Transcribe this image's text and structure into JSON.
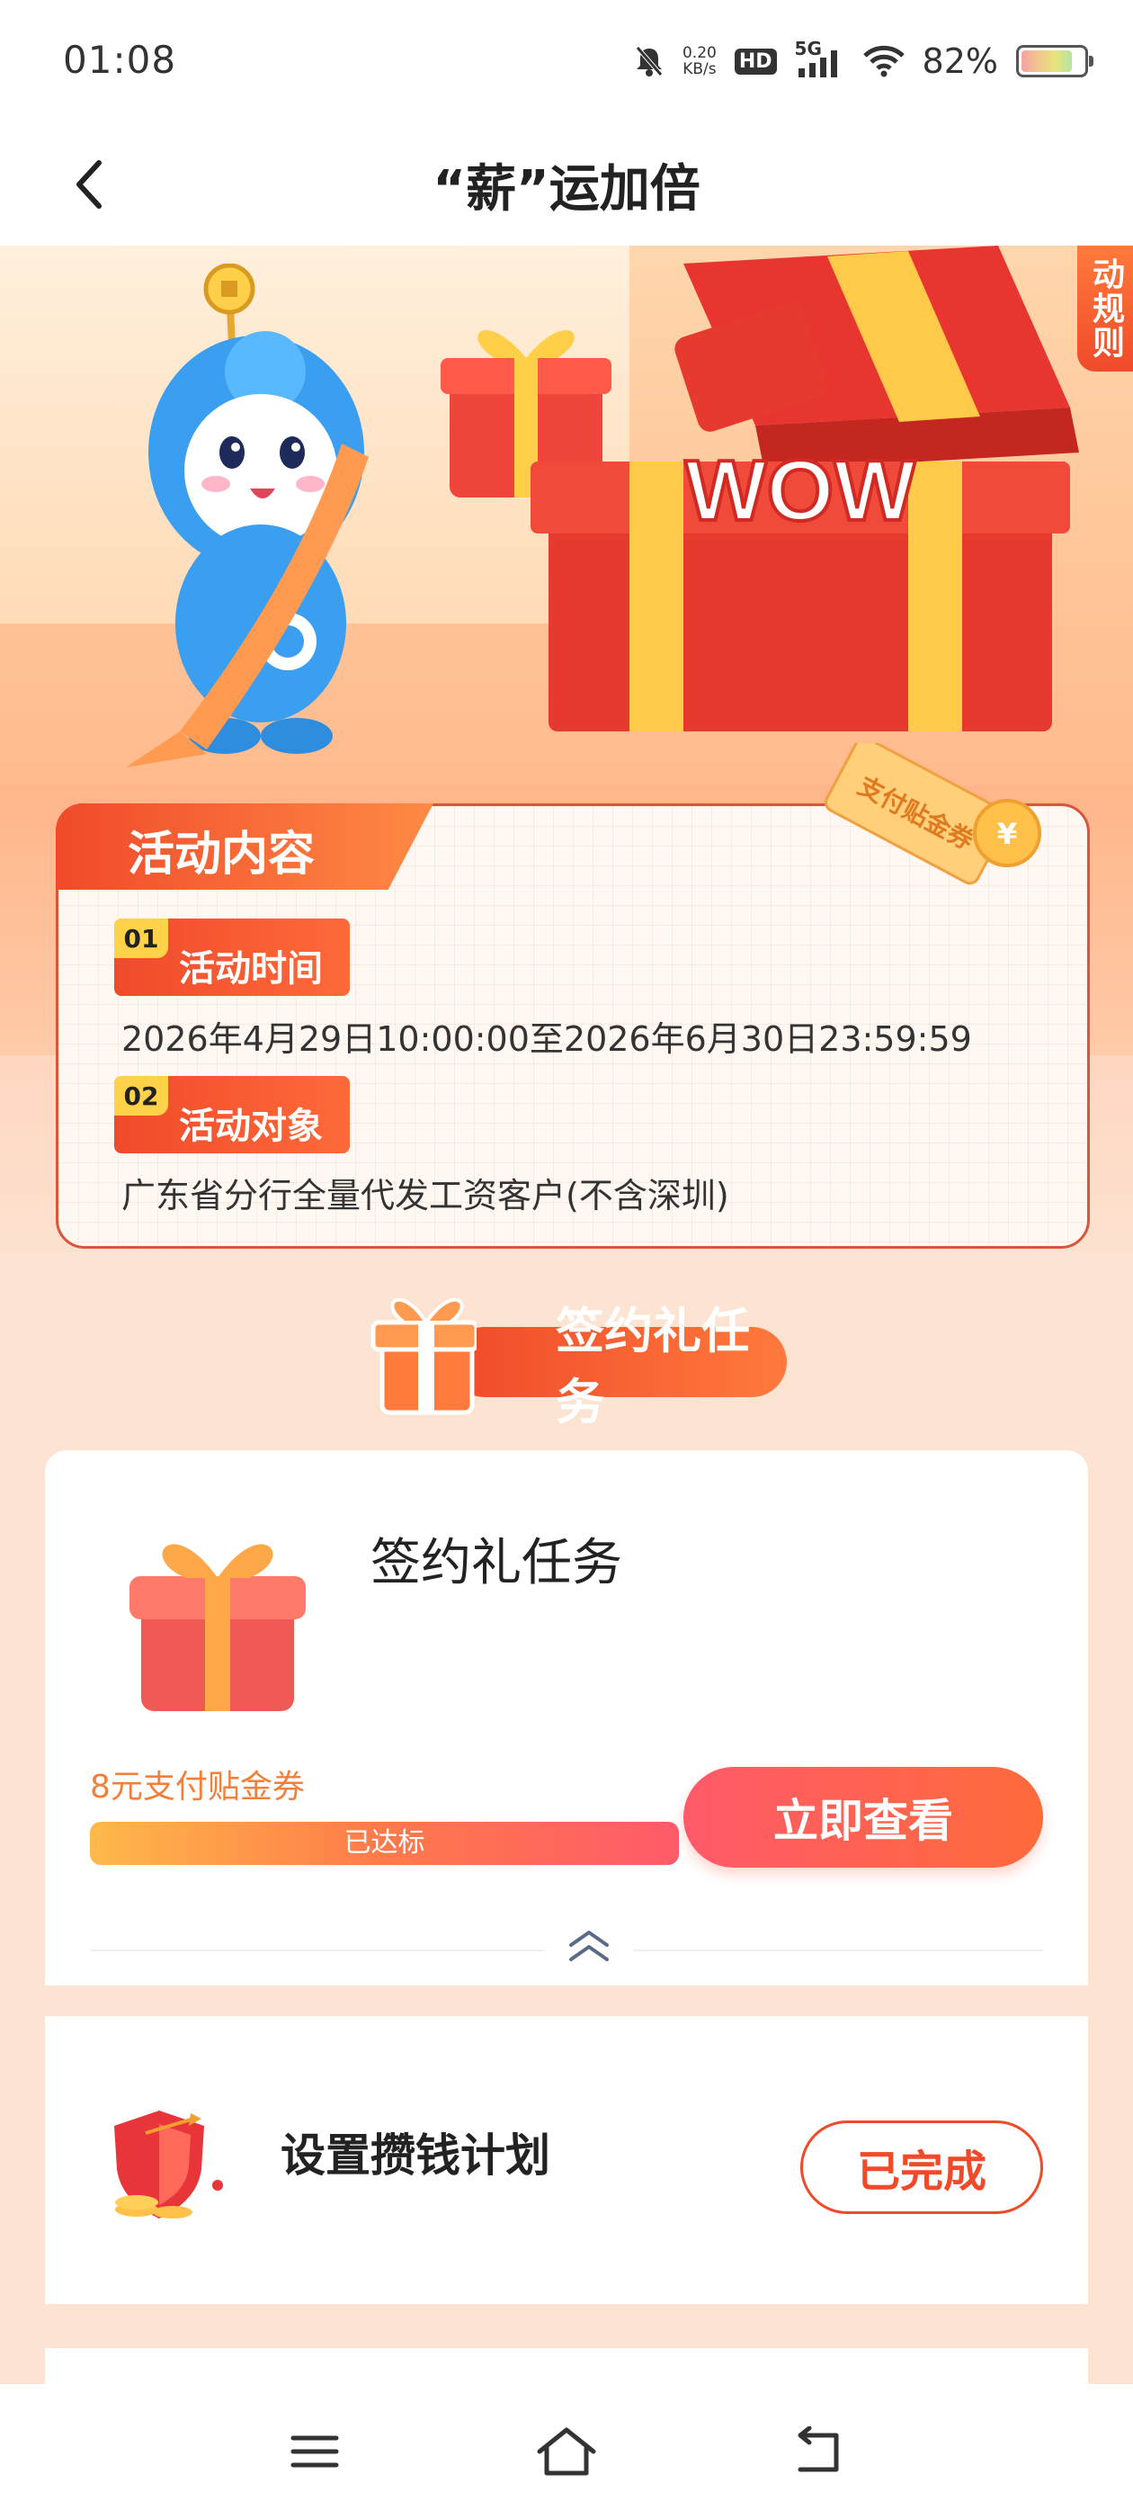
{
  "status_bar": {
    "time": "01:08",
    "net_speed_value": "0.20",
    "net_speed_unit": "KB/s",
    "hd": "HD",
    "signal_type": "5G",
    "battery": "82%"
  },
  "nav": {
    "title": "“薪”运加倍"
  },
  "hero": {
    "rules_tab": "动规则",
    "wow_text": "WOW",
    "coupon_text": "支付贴金券"
  },
  "activity": {
    "heading": "活动内容",
    "sections": [
      {
        "num": "01",
        "label": "活动时间",
        "text": "2026年4月29日10:00:00至2026年6月30日23:59:59"
      },
      {
        "num": "02",
        "label": "活动对象",
        "text": "广东省分行全量代发工资客户(不含深圳)"
      }
    ]
  },
  "task_banner": {
    "label": "签约礼任务"
  },
  "task_card": {
    "title": "签约礼任务",
    "reward": "8元支付贴金券",
    "progress": {
      "label": "已达标",
      "fraction": 1.0
    },
    "button": "立即查看"
  },
  "plan_card": {
    "title": "设置攒钱计划",
    "button": "已完成"
  },
  "colors": {
    "accent": "#f04a2a",
    "reward_text": "#f0803a"
  },
  "icons": {
    "back": "chevron-left-icon",
    "collapse": "double-chevron-up-icon",
    "menu": "menu-icon",
    "home": "home-icon",
    "back_nav": "return-icon"
  }
}
